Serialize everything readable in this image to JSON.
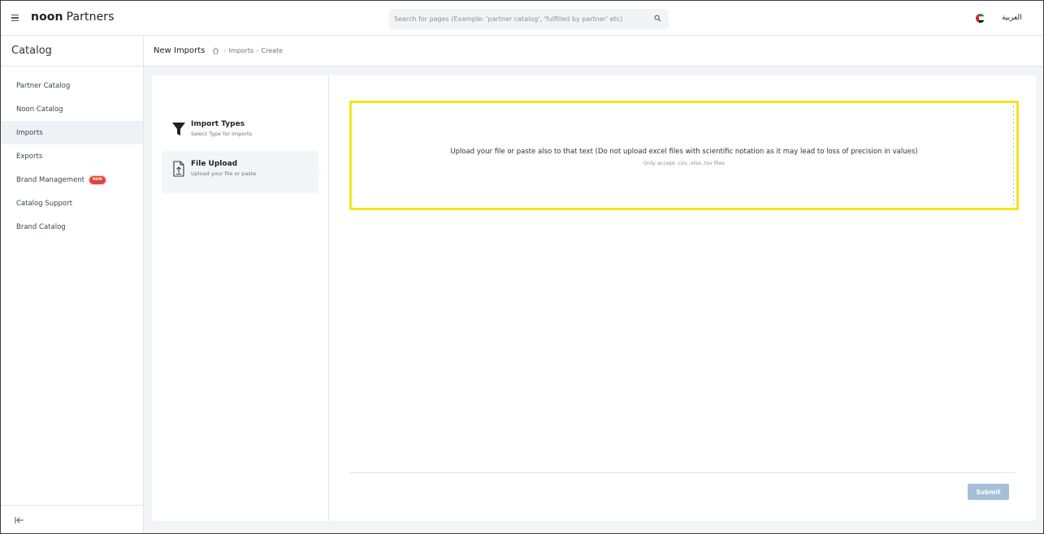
{
  "header": {
    "brand_bold": "noon",
    "brand_light": "Partners",
    "search_placeholder": "Search for pages (Example: 'partner catalog', 'fulfilled by partner' etc)",
    "language_label": "العربية"
  },
  "sidebar": {
    "title": "Catalog",
    "items": [
      {
        "label": "Partner Catalog",
        "active": false
      },
      {
        "label": "Noon Catalog",
        "active": false
      },
      {
        "label": "Imports",
        "active": true
      },
      {
        "label": "Exports",
        "active": false
      },
      {
        "label": "Brand Management",
        "active": false,
        "badge": "NEW"
      },
      {
        "label": "Catalog Support",
        "active": false
      },
      {
        "label": "Brand Catalog",
        "active": false
      }
    ]
  },
  "page": {
    "title": "New Imports",
    "breadcrumb": [
      "Imports",
      "Create"
    ]
  },
  "steps": [
    {
      "title": "Import Types",
      "desc": "Select Type for imports",
      "icon": "filter-icon"
    },
    {
      "title": "File Upload",
      "desc": "Upload your file or paste",
      "icon": "file-upload-icon",
      "active": true
    }
  ],
  "upload": {
    "main_text": "Upload your file or paste also to that text (Do not upload excel files with scientific notation as it may lead to loss of precision in values)",
    "sub_text": "Only accept .csv,.xlsx,.tsv files"
  },
  "actions": {
    "submit_label": "Submit"
  },
  "colors": {
    "highlight": "#f5e61a",
    "submit_disabled": "#a5bfd9",
    "badge": "#e0453a",
    "active_bg": "#eef1f6"
  }
}
